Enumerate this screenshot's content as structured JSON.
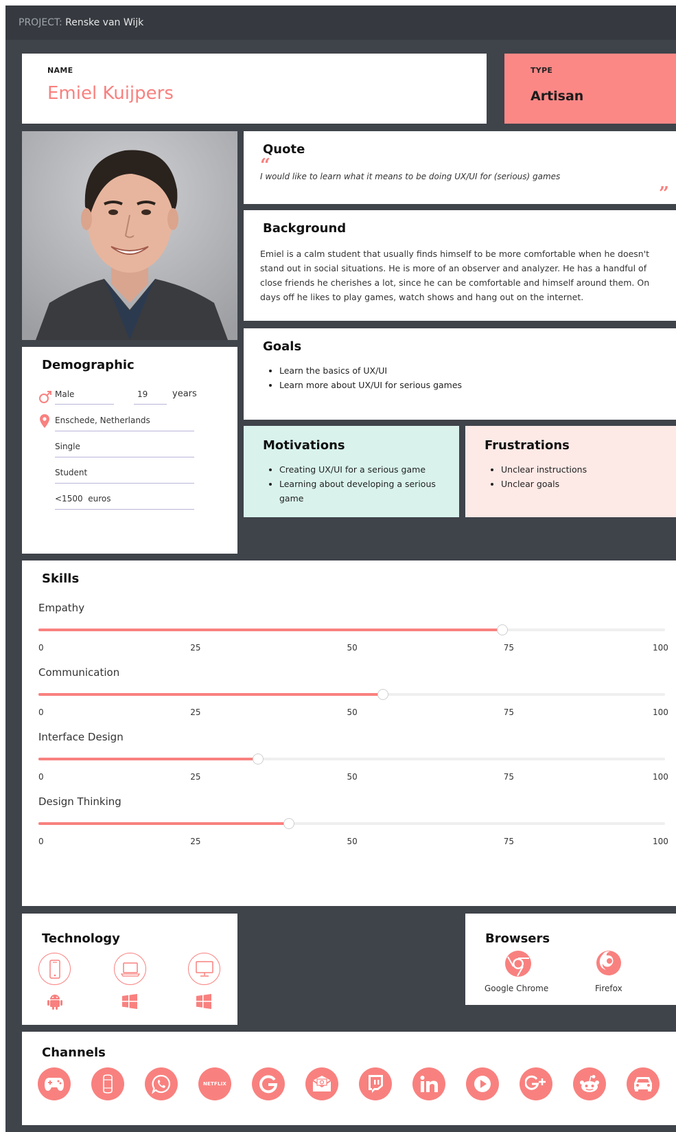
{
  "project": {
    "prefix": "PROJECT:",
    "name": "Renske van Wijk"
  },
  "persona": {
    "name_label": "NAME",
    "name": "Emiel Kuijpers",
    "type_label": "TYPE",
    "type": "Artisan"
  },
  "quote": {
    "title": "Quote",
    "open_mark": "“",
    "text": "I would like to learn what it means to be doing UX/UI for (serious) games",
    "close_mark": "”"
  },
  "background": {
    "title": "Background",
    "text": "Emiel is a calm student that usually finds himself to be more comfortable when he doesn't stand out in social situations. He is more of an observer and analyzer. He has a handful of close friends he cherishes a lot, since he can be comfortable and himself around them. On days off he likes to play games, watch shows and hang out on the internet."
  },
  "goals": {
    "title": "Goals",
    "items": [
      "Learn the basics of UX/UI",
      "Learn more about UX/UI for serious games"
    ]
  },
  "motivations": {
    "title": "Motivations",
    "items": [
      "Creating UX/UI for a serious game",
      "Learning about developing a serious game"
    ]
  },
  "frustrations": {
    "title": "Frustrations",
    "items": [
      "Unclear instructions",
      "Unclear goals"
    ]
  },
  "demographic": {
    "title": "Demographic",
    "gender": "Male",
    "age": "19",
    "age_unit": "years",
    "location": "Enschede, Netherlands",
    "relationship": "Single",
    "occupation": "Student",
    "income": "<1500  euros"
  },
  "skills": {
    "title": "Skills",
    "ticks": [
      "0",
      "25",
      "50",
      "75",
      "100"
    ],
    "items": [
      {
        "label": "Empathy",
        "value": 74
      },
      {
        "label": "Communication",
        "value": 55
      },
      {
        "label": "Interface Design",
        "value": 35
      },
      {
        "label": "Design Thinking",
        "value": 40
      }
    ]
  },
  "technology": {
    "title": "Technology",
    "devices": [
      "smartphone-icon",
      "laptop-icon",
      "desktop-icon"
    ],
    "os": [
      "android-icon",
      "windows-icon",
      "windows-icon"
    ]
  },
  "browsers": {
    "title": "Browsers",
    "items": [
      {
        "label": "Google Chrome",
        "icon": "chrome-icon"
      },
      {
        "label": "Firefox",
        "icon": "firefox-icon"
      }
    ]
  },
  "channels": {
    "title": "Channels",
    "netflix_text": "NETFLIX",
    "icons": [
      "gamepad-icon",
      "smart-speaker-icon",
      "whatsapp-icon",
      "netflix-icon",
      "google-icon",
      "email-icon",
      "twitch-icon",
      "linkedin-icon",
      "youtube-icon",
      "google-plus-icon",
      "reddit-icon",
      "car-icon"
    ]
  },
  "colors": {
    "accent": "#f8817f",
    "type_bg": "#fc8886",
    "frame": "#3f434a",
    "topbar": "#363a40",
    "motivations_bg": "#d9f3ec",
    "frustrations_bg": "#fde9e6"
  }
}
